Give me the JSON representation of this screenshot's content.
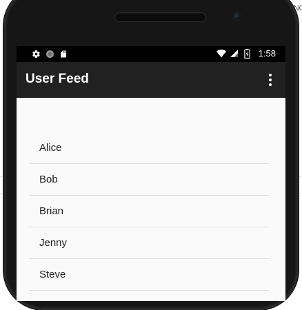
{
  "backdrop": {
    "caption": "256 PNG"
  },
  "status_bar": {
    "left_icons": [
      "settings-icon",
      "circle-icon",
      "sd-card-icon"
    ],
    "right_icons": [
      "wifi-icon",
      "cell-signal-icon",
      "battery-charging-icon"
    ],
    "time": "1:58"
  },
  "app_bar": {
    "title": "User Feed",
    "overflow_icon": "more-vert-icon"
  },
  "users": {
    "items": [
      {
        "name": "Alice"
      },
      {
        "name": "Bob"
      },
      {
        "name": "Brian"
      },
      {
        "name": "Jenny"
      },
      {
        "name": "Steve"
      }
    ]
  },
  "colors": {
    "status_bar": "#000000",
    "app_bar": "#212121",
    "content_bg": "#fafafa",
    "divider": "#dcdcdc",
    "bezel": "#161616"
  }
}
